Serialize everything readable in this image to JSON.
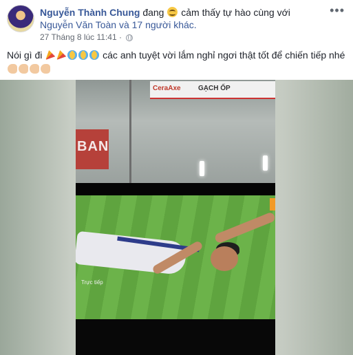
{
  "post": {
    "author": "Nguyễn Thành Chung",
    "feeling_prefix": "đang",
    "feeling_text": "cảm thấy tự hào cùng với",
    "tagged_user": "Nguyễn Văn Toàn",
    "tagged_joiner": "và",
    "tagged_others": "17 người khác.",
    "timestamp": "27 Tháng 8 lúc 11:41",
    "timestamp_separator": "·",
    "more_label": "•••",
    "text_part1": "Nói gì đi",
    "text_part2": "các anh tuyệt vời lắm nghỉ ngơi thật tốt để chiến tiếp nhé",
    "icons": [
      "feeling-proud-emoji",
      "party-popper-icon",
      "tears-of-joy-emoji",
      "flexed-biceps-icon",
      "globe-icon"
    ]
  },
  "media": {
    "board_brand_1": "CeraAxe",
    "board_brand_2": "GẠCH ỐP",
    "banner_text": "BAN",
    "overlay_caption": "Trực tiếp",
    "accent_color": "#385898"
  }
}
